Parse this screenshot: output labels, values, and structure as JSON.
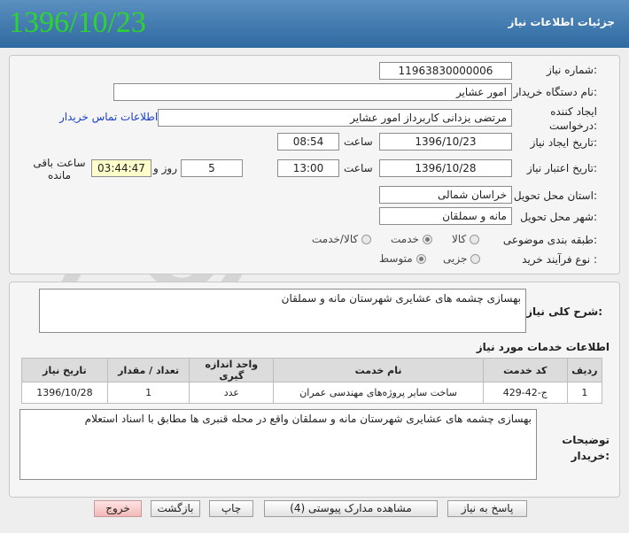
{
  "header": {
    "title": "جزئیات اطلاعات نیاز",
    "date_stamp": "1396/10/23"
  },
  "form": {
    "need_number_label": "شماره نیاز:",
    "need_number": "1196383000000‌6",
    "buyer_org_label": "نام دستگاه خریدار:",
    "buyer_org": "امور عشایر",
    "creator_label_line1": "ایجاد کننده",
    "creator_label_line2": "درخواست:",
    "creator": "مرتضی  یزدانی کاربرداز   امور عشایر",
    "contact_link": "اطلاعات تماس خریدار",
    "created_date_label": "تاریخ ایجاد نیاز:",
    "created_date": "1396/10/23",
    "time_label": "ساعت",
    "created_time": "08:54",
    "validity_label": "تاریخ اعتبار نیاز:",
    "validity_date": "1396/10/28",
    "validity_time": "13:00",
    "days_value": "5",
    "days_label": "روز و",
    "remaining_time": "03:44:47",
    "remaining_label": "ساعت باقی مانده",
    "province_label": "استان محل تحویل:",
    "province": "خراسان شمالی",
    "city_label": "شهر محل تحویل:",
    "city": "مانه و سملقان",
    "category_label": "طبقه بندی موضوعی:",
    "category_options": [
      "کالا",
      "خدمت",
      "کالا/خدمت"
    ],
    "category_selected": "خدمت",
    "process_label": "نوع فرآیند خرید :",
    "process_options": [
      "جزیی",
      "متوسط"
    ],
    "process_selected": "متوسط"
  },
  "summary": {
    "label": "شرح کلی نیاز:",
    "text": "بهسازی چشمه های عشایری شهرستان مانه و سملقان"
  },
  "services": {
    "title": "اطلاعات خدمات مورد نیاز",
    "columns": [
      "ردیف",
      "کد خدمت",
      "نام خدمت",
      "واحد اندازه گیری",
      "تعداد / مقدار",
      "تاریخ نیاز"
    ],
    "rows": [
      [
        "1",
        "ج-42-429",
        "ساخت سایر پروژه‌های مهندسی عمران",
        "عدد",
        "1",
        "1396/10/28"
      ]
    ]
  },
  "buyer_notes": {
    "label_line1": "توضیحات",
    "label_line2": "خریدار:",
    "text": "بهسازی چشمه های عشایری شهرستان مانه و سملقان واقع در محله قنبری ها مطابق با اسناد استعلام"
  },
  "buttons": {
    "reply": "پاسخ به نیاز",
    "attachments": "مشاهده مدارک پیوستی (4)",
    "print": "چاپ",
    "back": "بازگشت",
    "exit": "خروج"
  },
  "colors": {
    "header_top": "#5a8fc0",
    "header_bottom": "#2f6aa0",
    "date_stamp": "#2dd42d",
    "link": "#1a3fcc",
    "remaining_bg": "#ffffcc",
    "exit_button": "#f3b8b8"
  }
}
